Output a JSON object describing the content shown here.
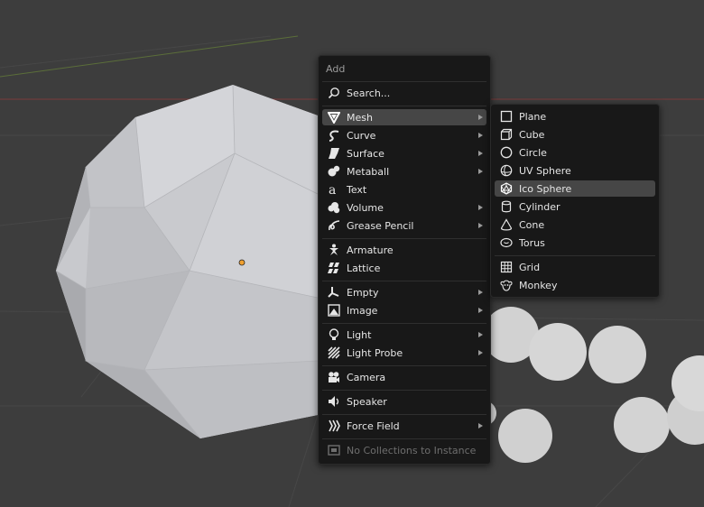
{
  "add_menu": {
    "title": "Add",
    "search_label": "Search...",
    "items": [
      {
        "label": "Mesh",
        "icon": "mesh-icon",
        "submenu": true,
        "active": true
      },
      {
        "label": "Curve",
        "icon": "curve-icon",
        "submenu": true
      },
      {
        "label": "Surface",
        "icon": "surface-icon",
        "submenu": true
      },
      {
        "label": "Metaball",
        "icon": "metaball-icon",
        "submenu": true
      },
      {
        "label": "Text",
        "icon": "text-icon",
        "submenu": false
      },
      {
        "label": "Volume",
        "icon": "volume-icon",
        "submenu": true
      },
      {
        "label": "Grease Pencil",
        "icon": "grease-pencil-icon",
        "submenu": true
      },
      {
        "label": "Armature",
        "icon": "armature-icon",
        "submenu": false
      },
      {
        "label": "Lattice",
        "icon": "lattice-icon",
        "submenu": false
      },
      {
        "label": "Empty",
        "icon": "empty-icon",
        "submenu": true
      },
      {
        "label": "Image",
        "icon": "image-icon",
        "submenu": true
      },
      {
        "label": "Light",
        "icon": "light-icon",
        "submenu": true
      },
      {
        "label": "Light Probe",
        "icon": "light-probe-icon",
        "submenu": true
      },
      {
        "label": "Camera",
        "icon": "camera-icon",
        "submenu": false
      },
      {
        "label": "Speaker",
        "icon": "speaker-icon",
        "submenu": false
      },
      {
        "label": "Force Field",
        "icon": "force-field-icon",
        "submenu": true
      },
      {
        "label": "No Collections to Instance",
        "icon": "collection-instance-icon",
        "submenu": false,
        "disabled": true
      }
    ]
  },
  "mesh_submenu": {
    "items": [
      {
        "label": "Plane",
        "icon": "plane-icon"
      },
      {
        "label": "Cube",
        "icon": "cube-icon"
      },
      {
        "label": "Circle",
        "icon": "circle-icon"
      },
      {
        "label": "UV Sphere",
        "icon": "uv-sphere-icon"
      },
      {
        "label": "Ico Sphere",
        "icon": "ico-sphere-icon",
        "active": true
      },
      {
        "label": "Cylinder",
        "icon": "cylinder-icon"
      },
      {
        "label": "Cone",
        "icon": "cone-icon"
      },
      {
        "label": "Torus",
        "icon": "torus-icon"
      },
      {
        "label": "Grid",
        "icon": "grid-icon"
      },
      {
        "label": "Monkey",
        "icon": "monkey-icon"
      }
    ]
  },
  "colors": {
    "viewport_bg": "#3d3d3d",
    "menu_bg": "#181818",
    "highlight": "#464646",
    "origin_dot": "#f0a030"
  }
}
